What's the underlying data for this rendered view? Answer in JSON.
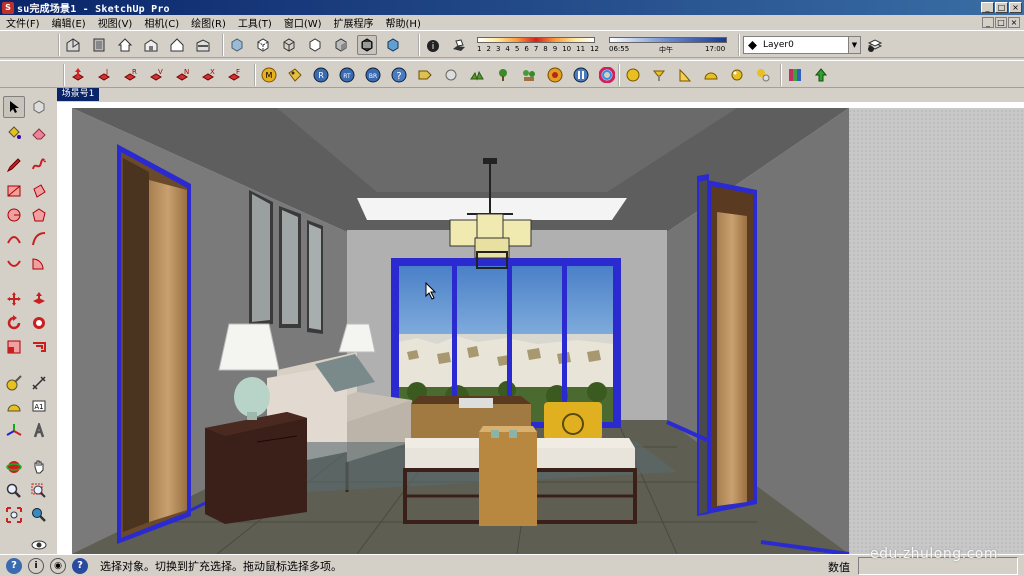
{
  "window": {
    "title": "su完成场景1 - SketchUp Pro",
    "min": "_",
    "max": "□",
    "close": "×"
  },
  "menu": {
    "items": [
      "文件(F)",
      "编辑(E)",
      "视图(V)",
      "相机(C)",
      "绘图(R)",
      "工具(T)",
      "窗口(W)",
      "扩展程序",
      "帮助(H)"
    ],
    "mdi": [
      "_",
      "□",
      "×"
    ]
  },
  "toolbar": {
    "shadow_month_scale": [
      "1",
      "2",
      "3",
      "4",
      "5",
      "6",
      "7",
      "8",
      "9",
      "10",
      "11",
      "12"
    ],
    "time_start": "06:55",
    "time_mid": "中午",
    "time_end": "17:00",
    "layer": "Layer0",
    "ext_labels": [
      "J",
      "R",
      "V",
      "N",
      "X",
      "F"
    ],
    "circle_labels": [
      "M",
      "R",
      "RT",
      "BR"
    ]
  },
  "scene_tab": {
    "label": "场景号1"
  },
  "status": {
    "help_icon": "?",
    "info_icon": "i",
    "text": "选择对象。切换到扩充选择。拖动鼠标选择多项。",
    "value_label": "数值",
    "value": ""
  },
  "watermark": "edu.zhulong.com",
  "colors": {
    "selection_edge": "#2a2ad0",
    "accent": "#0a246a",
    "wall": "#7a7a7a",
    "floor": "#5e5e52"
  }
}
